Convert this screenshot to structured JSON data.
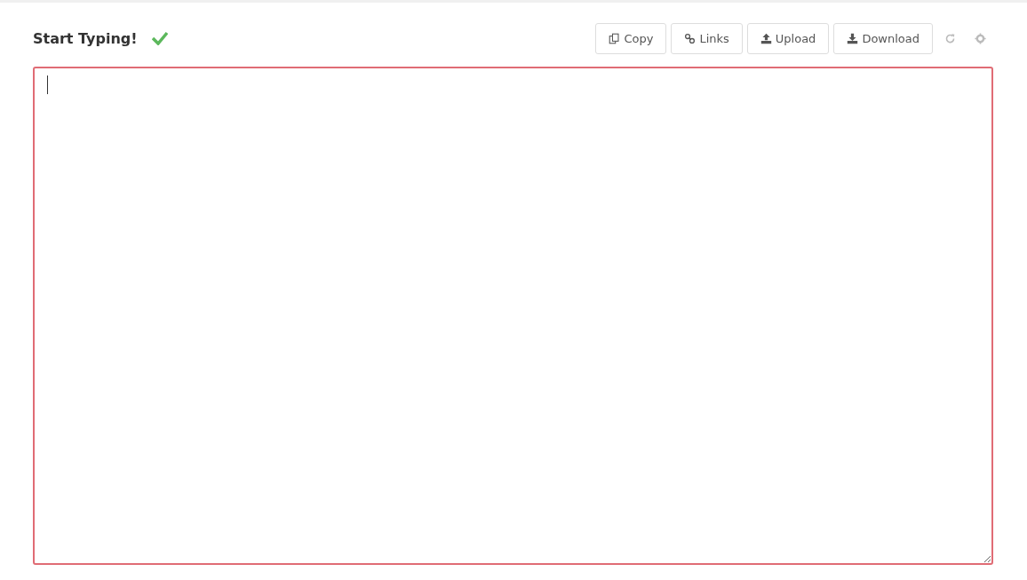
{
  "header": {
    "title": "Start Typing!",
    "saved": true
  },
  "toolbar": [
    {
      "kind": "copy",
      "label": "Copy"
    },
    {
      "kind": "link",
      "label": "Links"
    },
    {
      "kind": "upload",
      "label": "Upload"
    },
    {
      "kind": "download",
      "label": "Download"
    },
    {
      "kind": "refresh"
    },
    {
      "kind": "settings"
    }
  ],
  "editor": {
    "invalid": true
  }
}
